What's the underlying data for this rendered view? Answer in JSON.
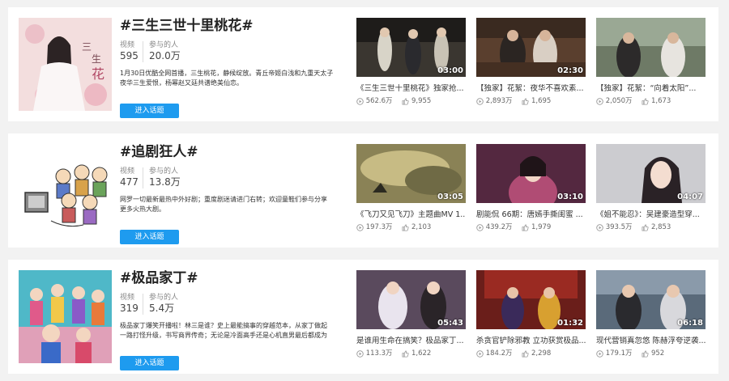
{
  "labels": {
    "videos": "视频",
    "participants": "参与的人",
    "join": "进入话题"
  },
  "topics": [
    {
      "title": "#三生三世十里桃花#",
      "video_count": "595",
      "participant_count": "20.0万",
      "description": "1月30日优酷全网首播，三生桃花，静候绽放。青丘帝姬白浅和九重天太子夜华三生爱恨，桃花树下终再续前缘。",
      "description_line1": "1月30日优酷全网首播，三生桃花，静候绽放。青丘帝姬白浅和九重天太子",
      "description_line2": "夜华三生爱恨，杨幂赵又廷共谱绝美仙恋。",
      "videos": [
        {
          "title": "《三生三世十里桃花》独家抢...",
          "duration": "03:00",
          "views": "562.6万",
          "likes": "9,955"
        },
        {
          "title": "【独家】花絮：夜华不喜欢素...",
          "duration": "02:30",
          "views": "2,893万",
          "likes": "1,695"
        },
        {
          "title": "【独家】花絮：“向着太阳”...",
          "duration": "",
          "views": "2,050万",
          "likes": "1,673"
        }
      ]
    },
    {
      "title": "#追剧狂人#",
      "video_count": "477",
      "participant_count": "13.8万",
      "description_line1": "网罗一切最新最热中外好剧；重度剧迷请进门右转；欢迎童鞋们参与分享",
      "description_line2": "更多火热大剧。",
      "videos": [
        {
          "title": "《飞刀又见飞刀》主题曲MV 1...",
          "duration": "03:05",
          "views": "197.3万",
          "likes": "2,103"
        },
        {
          "title": "剧能侃 66期：唐嫣手撕闺蜜 ...",
          "duration": "03:10",
          "views": "439.2万",
          "likes": "1,979"
        },
        {
          "title": "《姐不能忍》：吴建豪造型穿...",
          "duration": "04:07",
          "views": "393.5万",
          "likes": "2,853"
        }
      ]
    },
    {
      "title": "#极品家丁#",
      "video_count": "319",
      "participant_count": "5.4万",
      "description_line1": "极品家丁爆笑开播啦！林三是谁？史上最能搞事的穿越范本，从家丁做起",
      "description_line2": "一路打怪升级，书写商界传奇；无论是冷面高手还是心机直男最后都成为",
      "videos": [
        {
          "title": "是谁用生命在搞笑？极品家丁...",
          "duration": "05:43",
          "views": "113.3万",
          "likes": "1,622"
        },
        {
          "title": "杀贪官铲除邪教 立功获赏极品...",
          "duration": "01:32",
          "views": "184.2万",
          "likes": "2,298"
        },
        {
          "title": "现代营销真忽悠 陈赫浮夸逆袭...",
          "duration": "06:18",
          "views": "179.1万",
          "likes": "952"
        }
      ]
    }
  ],
  "colors": {
    "accent": "#1e9bef",
    "background": "#f2f2f2"
  }
}
